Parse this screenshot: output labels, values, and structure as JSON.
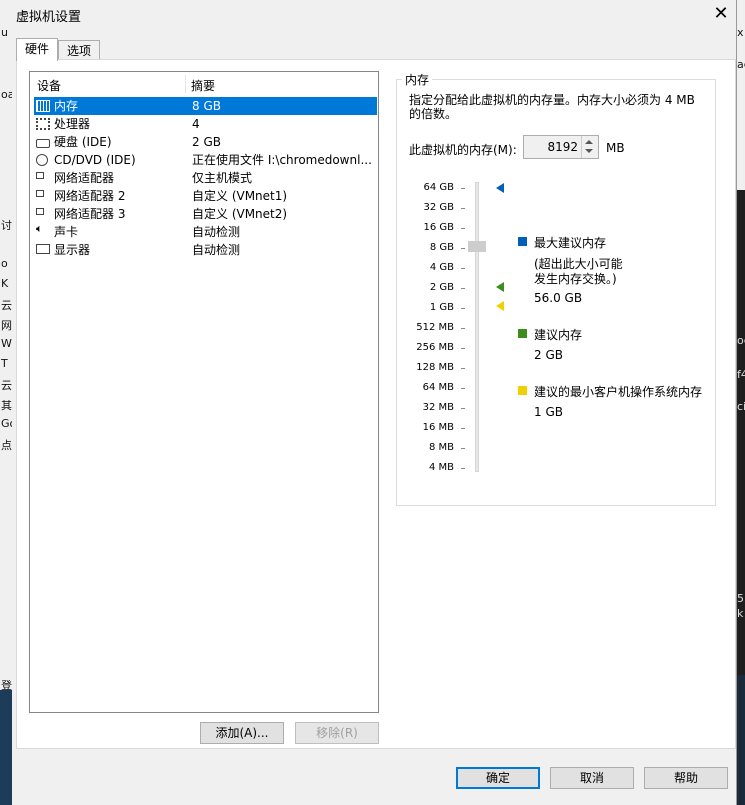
{
  "dialog": {
    "title": "虚拟机设置"
  },
  "tabs": [
    "硬件",
    "选项"
  ],
  "device_list": {
    "headers": [
      "设备",
      "摘要"
    ],
    "rows": [
      {
        "name": "内存",
        "summary": "8 GB",
        "icon": "memory-icon"
      },
      {
        "name": "处理器",
        "summary": "4",
        "icon": "cpu-icon"
      },
      {
        "name": "硬盘 (IDE)",
        "summary": "2 GB",
        "icon": "disk-icon"
      },
      {
        "name": "CD/DVD (IDE)",
        "summary": "正在使用文件 I:\\chromedownl...",
        "icon": "cd-icon"
      },
      {
        "name": "网络适配器",
        "summary": "仅主机模式",
        "icon": "network-icon"
      },
      {
        "name": "网络适配器 2",
        "summary": "自定义 (VMnet1)",
        "icon": "network-icon"
      },
      {
        "name": "网络适配器 3",
        "summary": "自定义 (VMnet2)",
        "icon": "network-icon"
      },
      {
        "name": "声卡",
        "summary": "自动检测",
        "icon": "sound-icon"
      },
      {
        "name": "显示器",
        "summary": "自动检测",
        "icon": "display-icon"
      }
    ],
    "selected_index": 0
  },
  "buttons": {
    "add": "添加(A)...",
    "remove": "移除(R)",
    "ok": "确定",
    "cancel": "取消",
    "help": "帮助"
  },
  "memory": {
    "group_title": "内存",
    "description": "指定分配给此虚拟机的内存量。内存大小必须为 4 MB 的倍数。",
    "field_label": "此虚拟机的内存(M):",
    "value": "8192",
    "unit": "MB",
    "scale_labels": [
      "64 GB",
      "32 GB",
      "16 GB",
      "8 GB",
      "4 GB",
      "2 GB",
      "1 GB",
      "512 MB",
      "256 MB",
      "128 MB",
      "64 MB",
      "32 MB",
      "16 MB",
      "8 MB",
      "4 MB"
    ],
    "legend": {
      "max": {
        "title": "最大建议内存",
        "note": "(超出此大小可能\n发生内存交换。)",
        "value": "56.0 GB",
        "color": "#005fb8"
      },
      "recommended": {
        "title": "建议内存",
        "value": "2 GB",
        "color": "#3c8c1e"
      },
      "min": {
        "title": "建议的最小客户机操作系统内存",
        "value": "1 GB",
        "color": "#f0d000"
      }
    }
  },
  "background": {
    "left_fragments": [
      "u",
      "oa",
      "讨",
      "o",
      "K",
      "云",
      "网",
      "W",
      "T",
      "云",
      "其",
      "Go",
      "点",
      "登"
    ],
    "right_fragments": [
      "x",
      "ac",
      "oc",
      "f4",
      "ci",
      "5",
      "k"
    ]
  }
}
